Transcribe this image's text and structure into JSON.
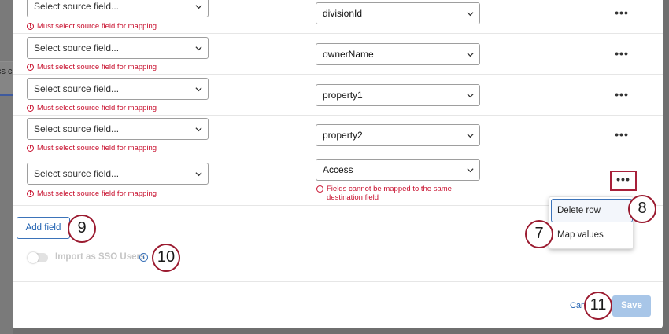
{
  "background": {
    "fragment_text": "cs c"
  },
  "mapping_rows": [
    {
      "source_placeholder": "Select source field...",
      "source_error": "Must select source field for mapping",
      "destination": "divisionId",
      "row_menu": "•••"
    },
    {
      "source_placeholder": "Select source field...",
      "source_error": "Must select source field for mapping",
      "destination": "ownerName",
      "row_menu": "•••"
    },
    {
      "source_placeholder": "Select source field...",
      "source_error": "Must select source field for mapping",
      "destination": "property1",
      "row_menu": "•••"
    },
    {
      "source_placeholder": "Select source field...",
      "source_error": "Must select source field for mapping",
      "destination": "property2",
      "row_menu": "•••"
    },
    {
      "source_placeholder": "Select source field...",
      "source_error": "Must select source field for mapping",
      "destination": "Access",
      "destination_error": "Fields cannot be mapped to the same destination field",
      "row_menu": "•••"
    }
  ],
  "row_menu": {
    "items": [
      "Delete row",
      "Map values"
    ]
  },
  "add_field_label": "Add field",
  "sso_toggle": {
    "label": "Import as SSO Users",
    "enabled": false
  },
  "footer": {
    "cancel_label": "Can",
    "save_label": "Save"
  },
  "callouts": {
    "delete_row": "8",
    "map_values": "7",
    "add_field": "9",
    "sso_info": "10",
    "save": "11"
  },
  "colors": {
    "error": "#c8102e",
    "accent": "#3b73b9",
    "callout_border": "#9b1b30",
    "save_disabled": "#a8c6e8"
  }
}
